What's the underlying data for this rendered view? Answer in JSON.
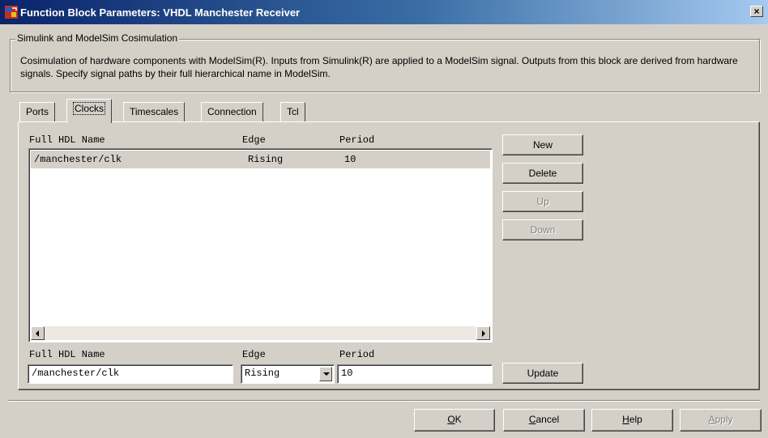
{
  "window": {
    "title": "Function Block Parameters: VHDL Manchester Receiver",
    "close_label": "×"
  },
  "group": {
    "title": "Simulink and ModelSim Cosimulation",
    "description": "Cosimulation of hardware components with ModelSim(R). Inputs from Simulink(R) are applied to a ModelSim signal. Outputs from this block are derived from hardware signals. Specify signal paths by their full hierarchical name in ModelSim."
  },
  "tabs": [
    {
      "label": "Ports"
    },
    {
      "label": "Clocks",
      "active": true
    },
    {
      "label": "Timescales"
    },
    {
      "label": "Connection"
    },
    {
      "label": "Tcl"
    }
  ],
  "clocks_table": {
    "columns": [
      "Full HDL Name",
      "Edge",
      "Period"
    ],
    "rows": [
      {
        "name": "/manchester/clk",
        "edge": "Rising",
        "period": "10"
      }
    ]
  },
  "side_buttons": {
    "new": "New",
    "delete": "Delete",
    "up": "Up",
    "down": "Down",
    "update": "Update"
  },
  "editor": {
    "name_label": "Full HDL Name",
    "edge_label": "Edge",
    "period_label": "Period",
    "name_value": "/manchester/clk",
    "edge_value": "Rising",
    "period_value": "10"
  },
  "footer": {
    "ok": {
      "first": "O",
      "rest": "K"
    },
    "cancel": {
      "first": "C",
      "rest": "ancel"
    },
    "help": {
      "first": "H",
      "rest": "elp"
    },
    "apply": {
      "first": "A",
      "rest": "pply"
    }
  },
  "colors": {
    "face": "#d4d0c8",
    "title_start": "#0a246a",
    "title_end": "#a6caf0"
  },
  "icons": {
    "app": "simulink-block-icon",
    "close": "close-icon",
    "scroll_left": "scroll-left-arrow-icon",
    "scroll_right": "scroll-right-arrow-icon",
    "dropdown": "chevron-down-icon"
  }
}
